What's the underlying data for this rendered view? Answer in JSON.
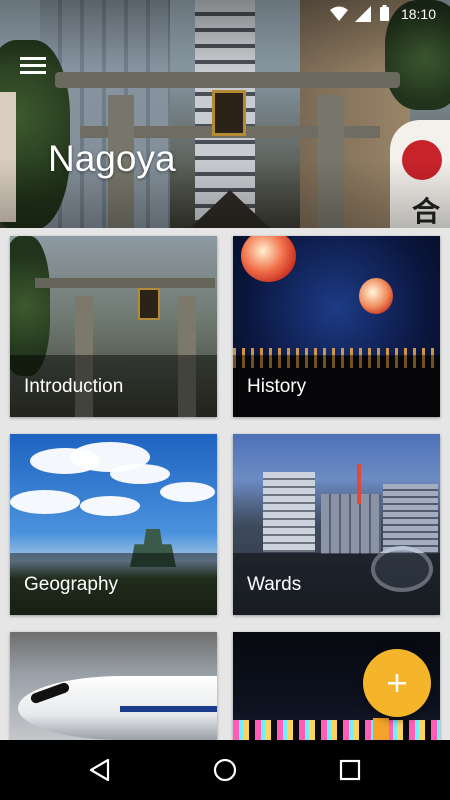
{
  "status_bar": {
    "time": "18:10"
  },
  "header": {
    "title": "Nagoya",
    "menu_icon": "hamburger-menu-icon"
  },
  "cards": [
    {
      "label": "Introduction"
    },
    {
      "label": "History"
    },
    {
      "label": "Geography"
    },
    {
      "label": "Wards"
    },
    {
      "label": ""
    },
    {
      "label": ""
    }
  ],
  "fab": {
    "icon": "plus-icon",
    "color": "#f4b52a"
  },
  "nav": {
    "back_icon": "back-triangle-icon",
    "home_icon": "home-circle-icon",
    "recent_icon": "recents-square-icon"
  }
}
